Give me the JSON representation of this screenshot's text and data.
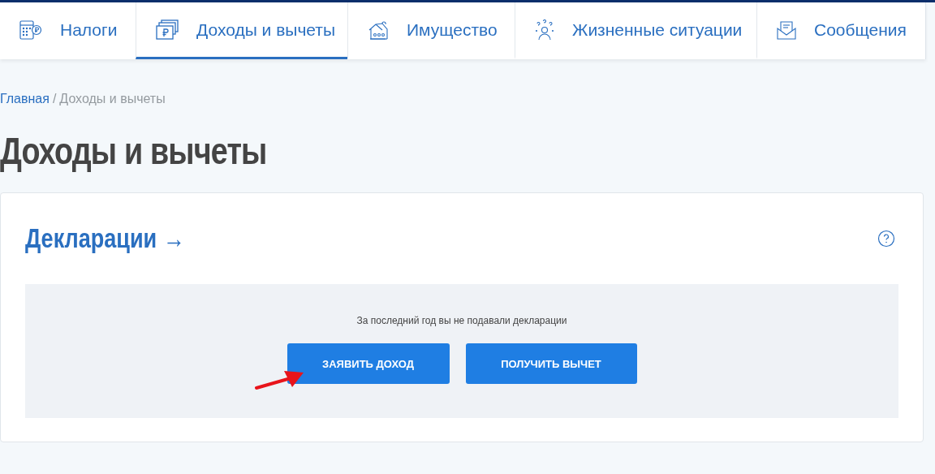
{
  "nav": {
    "tabs": [
      {
        "kind": "calculator",
        "label": "Налоги",
        "selected": false
      },
      {
        "kind": "money",
        "label": "Доходы и вычеты",
        "selected": true
      },
      {
        "kind": "house",
        "label": "Имущество",
        "selected": false
      },
      {
        "kind": "person",
        "label": "Жизненные ситуации",
        "selected": false
      },
      {
        "kind": "envelope",
        "label": "Сообщения",
        "selected": false
      }
    ]
  },
  "breadcrumb": {
    "home": "Главная",
    "separator": "/",
    "current": "Доходы и вычеты"
  },
  "page_title": "Доходы и вычеты",
  "declarations": {
    "title": "Декларации",
    "arrow": "→",
    "message": "За последний год вы не подавали декларации",
    "buttons": [
      "ЗАЯВИТЬ ДОХОД",
      "ПОЛУЧИТЬ ВЫЧЕТ"
    ]
  }
}
